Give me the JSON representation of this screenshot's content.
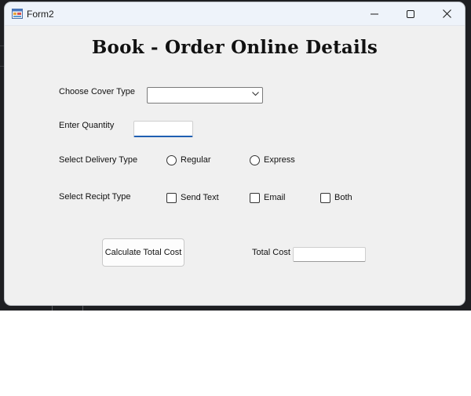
{
  "window": {
    "title": "Form2",
    "heading": "Book - Order Online Details"
  },
  "form": {
    "cover_type_label": "Choose Cover Type",
    "cover_type_value": "",
    "quantity_label": "Enter Quantity",
    "quantity_value": "",
    "delivery_label": "Select Delivery Type",
    "delivery_options": [
      "Regular",
      "Express"
    ],
    "receipt_label": "Select Recipt Type",
    "receipt_options": [
      "Send Text",
      "Email",
      "Both"
    ],
    "calculate_button": "Calculate Total Cost",
    "total_cost_label": "Total Cost",
    "total_cost_value": ""
  },
  "icons": {
    "app": "form-app-icon",
    "minimize": "minimize-icon",
    "maximize": "maximize-icon",
    "close": "close-icon",
    "dropdown": "chevron-down-icon"
  },
  "colors": {
    "focus_underline": "#1f5fb2",
    "window_bg": "#f0f0f0",
    "titlebar_bg": "#eef3fa"
  }
}
